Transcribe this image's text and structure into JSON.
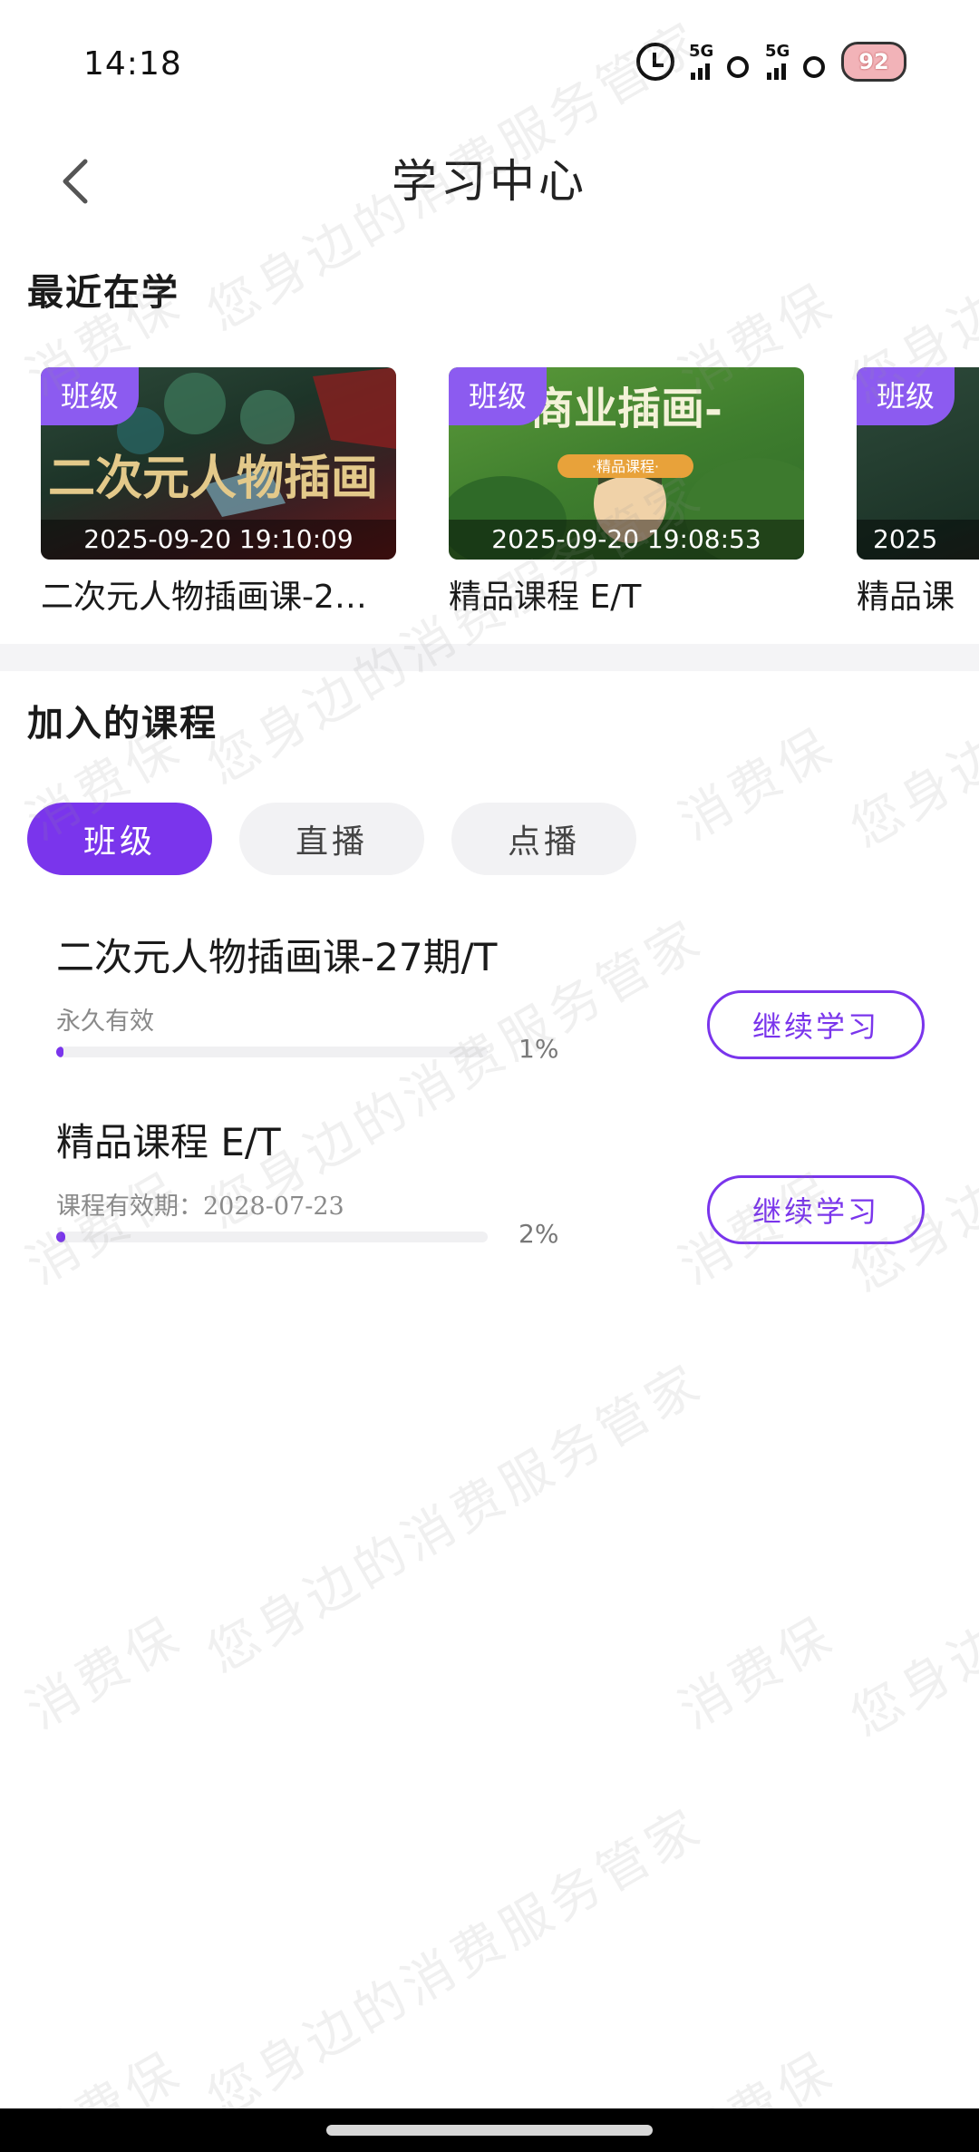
{
  "status_bar": {
    "time": "14:18",
    "signal_1": "5G",
    "signal_2": "5G",
    "battery": "92",
    "icons": [
      "alarm-icon",
      "signal-5g-icon",
      "signal-5g-icon",
      "battery-icon"
    ]
  },
  "header": {
    "title": "学习中心",
    "back_icon": "chevron-left-icon"
  },
  "recent": {
    "title": "最近在学",
    "items": [
      {
        "badge": "班级",
        "time": "2025-09-20 19:10:09",
        "title": "二次元人物插画课-2…",
        "thumb_text": "二次元人物插画"
      },
      {
        "badge": "班级",
        "time": "2025-09-20 19:08:53",
        "title": "精品课程 E/T",
        "thumb_text": "商业插画-",
        "thumb_sub": "·精品课程·"
      },
      {
        "badge": "班级",
        "time": "2025",
        "title": "精品课"
      }
    ]
  },
  "joined": {
    "title": "加入的课程",
    "tabs": [
      "班级",
      "直播",
      "点播"
    ],
    "active_tab": 0,
    "courses": [
      {
        "name": "二次元人物插画课-27期/T",
        "validity": "永久有效",
        "progress": 1,
        "progress_label": "1%",
        "button": "继续学习"
      },
      {
        "name": "精品课程 E/T",
        "validity": "课程有效期：2028-07-23",
        "progress": 2,
        "progress_label": "2%",
        "button": "继续学习"
      }
    ]
  },
  "watermark": [
    "消费保",
    "您身边的消费服务管家"
  ],
  "colors": {
    "accent": "#7a35ec",
    "badge": "#8c5bf0",
    "tab_inactive": "#f2f2f4",
    "divider": "#f4f4f6"
  }
}
